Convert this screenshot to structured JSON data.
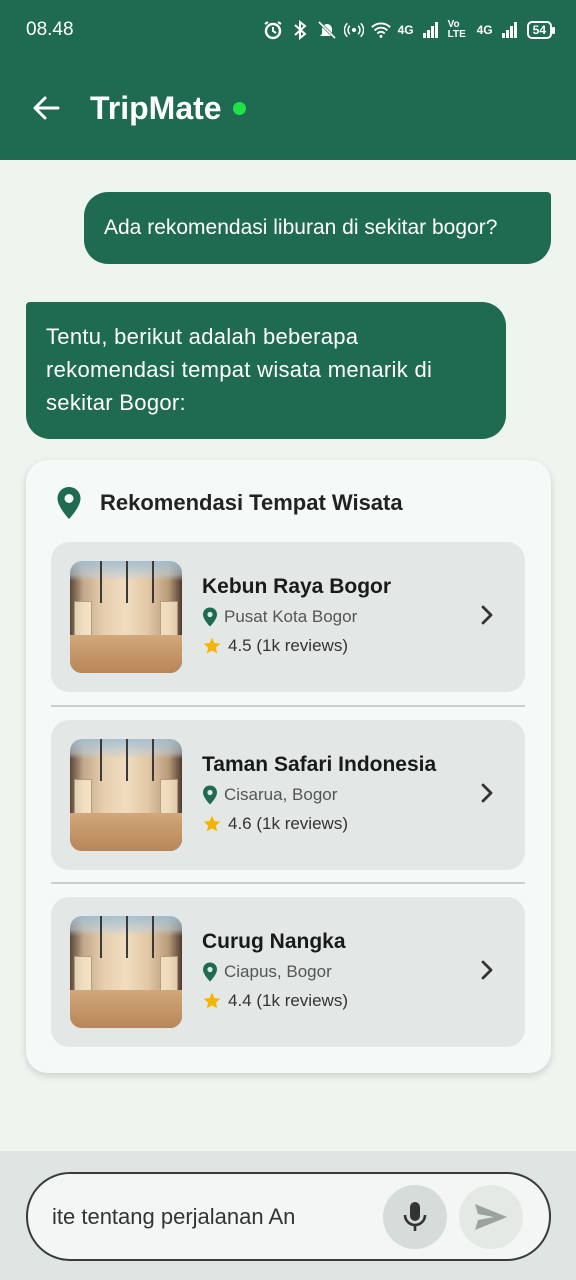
{
  "status_bar": {
    "time": "08.48",
    "battery": "54",
    "network_1": "4G",
    "volte": "Vo LTE",
    "network_2": "4G"
  },
  "header": {
    "title": "TripMate",
    "online_color": "#22e04a",
    "brand_color": "#1f6b52"
  },
  "messages": {
    "user": "Ada rekomendasi liburan di sekitar bogor?",
    "bot": "Tentu, berikut adalah beberapa rekomendasi tempat wisata menarik di sekitar Bogor:"
  },
  "recommendations": {
    "title": "Rekomendasi Tempat Wisata",
    "items": [
      {
        "name": "Kebun Raya Bogor",
        "location": "Pusat Kota Bogor",
        "rating": "4.5 (1k reviews)"
      },
      {
        "name": "Taman Safari Indonesia",
        "location": "Cisarua, Bogor",
        "rating": "4.6 (1k reviews)"
      },
      {
        "name": "Curug Nangka",
        "location": "Ciapus, Bogor",
        "rating": "4.4 (1k reviews)"
      }
    ]
  },
  "composer": {
    "value": "ite tentang perjalanan An",
    "icons": {
      "mic": "mic-icon",
      "send": "send-icon"
    }
  }
}
